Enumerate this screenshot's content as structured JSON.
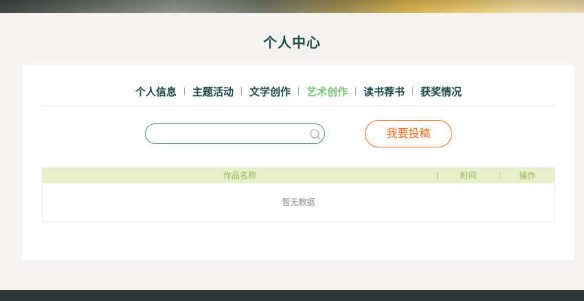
{
  "page": {
    "title": "个人中心"
  },
  "tabs": [
    {
      "label": "个人信息",
      "active": false
    },
    {
      "label": "主题活动",
      "active": false
    },
    {
      "label": "文学创作",
      "active": false
    },
    {
      "label": "艺术创作",
      "active": true
    },
    {
      "label": "读书荐书",
      "active": false
    },
    {
      "label": "获奖情况",
      "active": false
    }
  ],
  "search": {
    "value": "",
    "placeholder": ""
  },
  "submit_button": {
    "label": "我要投稿"
  },
  "table": {
    "columns": [
      "作品名称",
      "时间",
      "操作"
    ],
    "empty_text": "暂无数据"
  },
  "colors": {
    "accent": "#7cc07a",
    "primary_text": "#1e4a4a",
    "button": "#e86a1e",
    "table_header_bg": "#e9efca",
    "footer": "#2e3a3a"
  }
}
